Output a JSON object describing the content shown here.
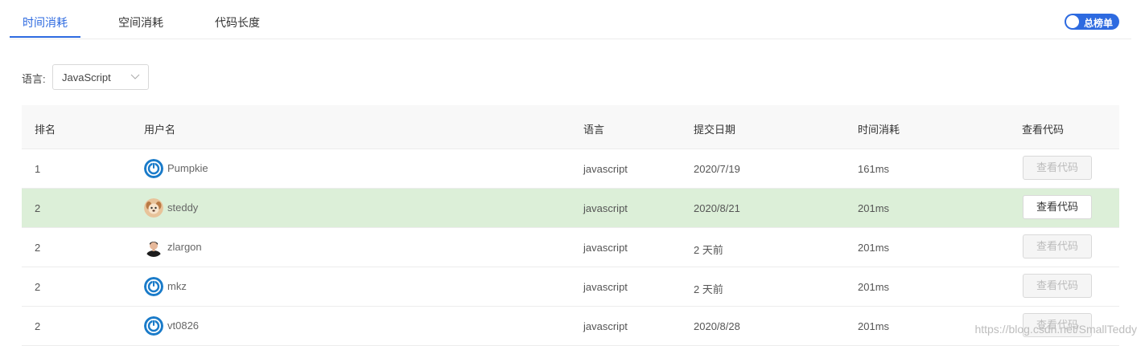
{
  "tabs": [
    {
      "label": "时间消耗"
    },
    {
      "label": "空间消耗"
    },
    {
      "label": "代码长度"
    }
  ],
  "active_tab": "时间消耗",
  "toggle": {
    "label": "总榜单",
    "on": true
  },
  "filter": {
    "label": "语言:",
    "value": "JavaScript"
  },
  "table": {
    "headers": {
      "rank": "排名",
      "user": "用户名",
      "language": "语言",
      "date": "提交日期",
      "time": "时间消耗",
      "code": "查看代码"
    },
    "rows": [
      {
        "rank": "1",
        "user": "Pumpkie",
        "avatar": "power-icon",
        "language": "javascript",
        "date": "2020/7/19",
        "time": "161ms",
        "button": "查看代码",
        "button_enabled": false,
        "highlight": false
      },
      {
        "rank": "2",
        "user": "steddy",
        "avatar": "dog-avatar",
        "language": "javascript",
        "date": "2020/8/21",
        "time": "201ms",
        "button": "查看代码",
        "button_enabled": true,
        "highlight": true
      },
      {
        "rank": "2",
        "user": "zlargon",
        "avatar": "person-avatar",
        "language": "javascript",
        "date": "2 天前",
        "time": "201ms",
        "button": "查看代码",
        "button_enabled": false,
        "highlight": false
      },
      {
        "rank": "2",
        "user": "mkz",
        "avatar": "power-icon",
        "language": "javascript",
        "date": "2 天前",
        "time": "201ms",
        "button": "查看代码",
        "button_enabled": false,
        "highlight": false
      },
      {
        "rank": "2",
        "user": "vt0826",
        "avatar": "power-icon",
        "language": "javascript",
        "date": "2020/8/28",
        "time": "201ms",
        "button": "查看代码",
        "button_enabled": false,
        "highlight": false
      }
    ]
  },
  "watermark": "https://blog.csdn.net/SmallTeddy",
  "colors": {
    "accent": "#2d6ae0",
    "highlight_row": "#dcefd8",
    "header_bg": "#f8f8f8"
  }
}
